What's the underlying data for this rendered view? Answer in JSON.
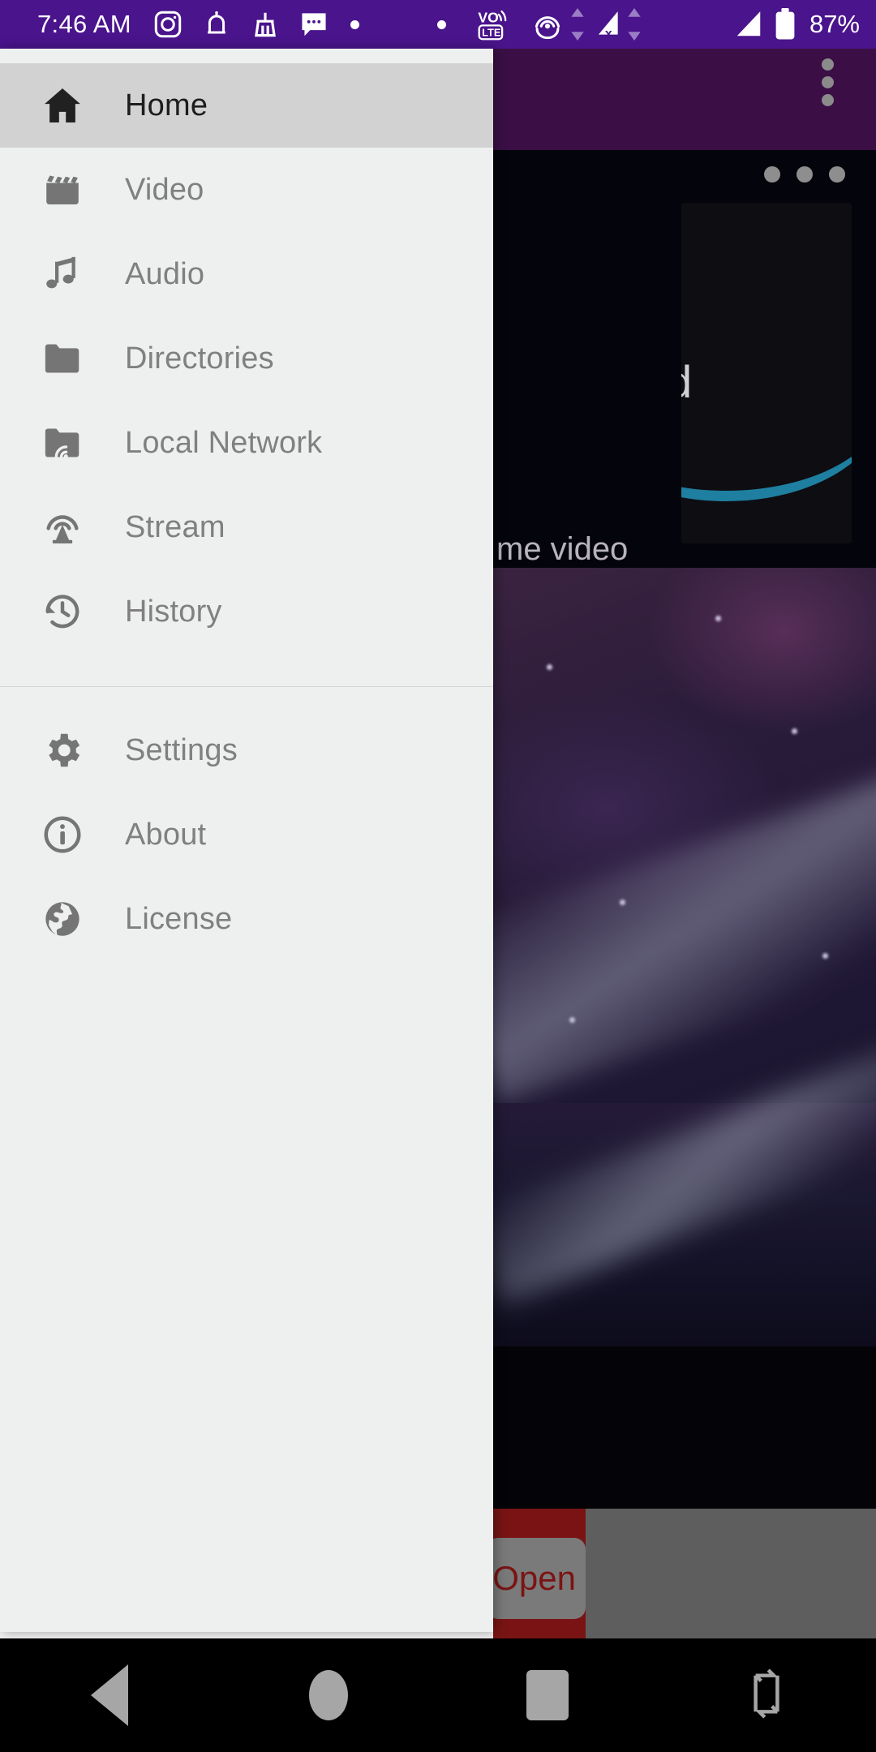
{
  "statusbar": {
    "time": "7:46 AM",
    "battery_percent": "87%",
    "background_color": "#4a148c",
    "icons": [
      "instagram-icon",
      "bell-icon",
      "broom-icon",
      "message-icon",
      "dot-icon",
      "dot-icon",
      "volte-icon",
      "hotspot-icon",
      "data-transfer-icon",
      "signal-off-icon",
      "data-transfer-icon",
      "signal-icon",
      "battery-icon"
    ]
  },
  "drawer": {
    "primary_items": [
      {
        "label": "Home",
        "icon": "home-icon",
        "selected": true
      },
      {
        "label": "Video",
        "icon": "video-icon",
        "selected": false
      },
      {
        "label": "Audio",
        "icon": "audio-icon",
        "selected": false
      },
      {
        "label": "Directories",
        "icon": "folder-icon",
        "selected": false
      },
      {
        "label": "Local Network",
        "icon": "network-folder-icon",
        "selected": false
      },
      {
        "label": "Stream",
        "icon": "stream-icon",
        "selected": false
      },
      {
        "label": "History",
        "icon": "history-icon",
        "selected": false
      }
    ],
    "secondary_items": [
      {
        "label": "Settings",
        "icon": "gear-icon",
        "selected": false
      },
      {
        "label": "About",
        "icon": "info-icon",
        "selected": false
      },
      {
        "label": "License",
        "icon": "globe-icon",
        "selected": false
      }
    ],
    "selected_background": "#d2d2d2",
    "background": "#eef0ef",
    "label_color": "#808080"
  },
  "background_app": {
    "appbar_color": "#3b0f46",
    "overflow_menu": "more-vertical-icon",
    "list_overflow": "more-horizontal-icon",
    "tile_label": "me video",
    "poster_text_prefix": "me vi",
    "poster_text_suffix": "d",
    "open_button_label": "Open",
    "open_button_text_color": "#7a1414"
  },
  "navbar": {
    "buttons": [
      {
        "name": "back-button",
        "icon": "triangle-left-icon"
      },
      {
        "name": "home-button",
        "icon": "circle-icon"
      },
      {
        "name": "recents-button",
        "icon": "square-icon"
      },
      {
        "name": "rotate-button",
        "icon": "rotate-icon"
      }
    ]
  }
}
